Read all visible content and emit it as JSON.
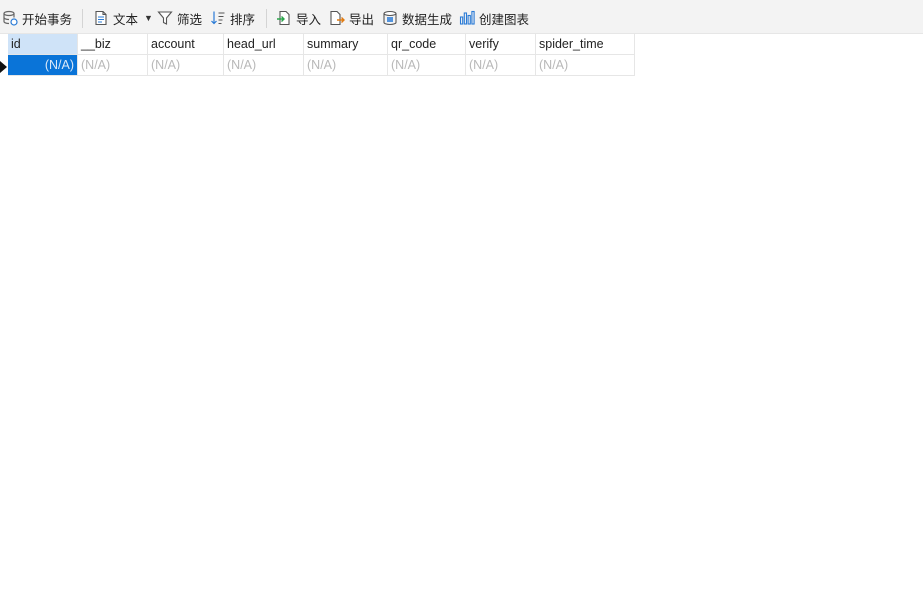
{
  "toolbar": {
    "begin_transaction": "开始事务",
    "text": "文本",
    "filter": "筛选",
    "sort": "排序",
    "import": "导入",
    "export": "导出",
    "data_generation": "数据生成",
    "create_chart": "创建图表",
    "icons": [
      "database-transaction-icon",
      "document-icon",
      "filter-funnel-icon",
      "sort-icon",
      "import-icon",
      "export-icon",
      "data-generation-icon",
      "chart-icon"
    ]
  },
  "table": {
    "columns": [
      "id",
      "__biz",
      "account",
      "head_url",
      "summary",
      "qr_code",
      "verify",
      "spider_time"
    ],
    "rows": [
      [
        "(N/A)",
        "(N/A)",
        "(N/A)",
        "(N/A)",
        "(N/A)",
        "(N/A)",
        "(N/A)",
        "(N/A)"
      ]
    ]
  },
  "colors": {
    "selection": "#0a74d8",
    "header_highlight": "#cfe3f8",
    "toolbar_bg": "#f3f3f3",
    "null_text": "#b8b8b8"
  }
}
